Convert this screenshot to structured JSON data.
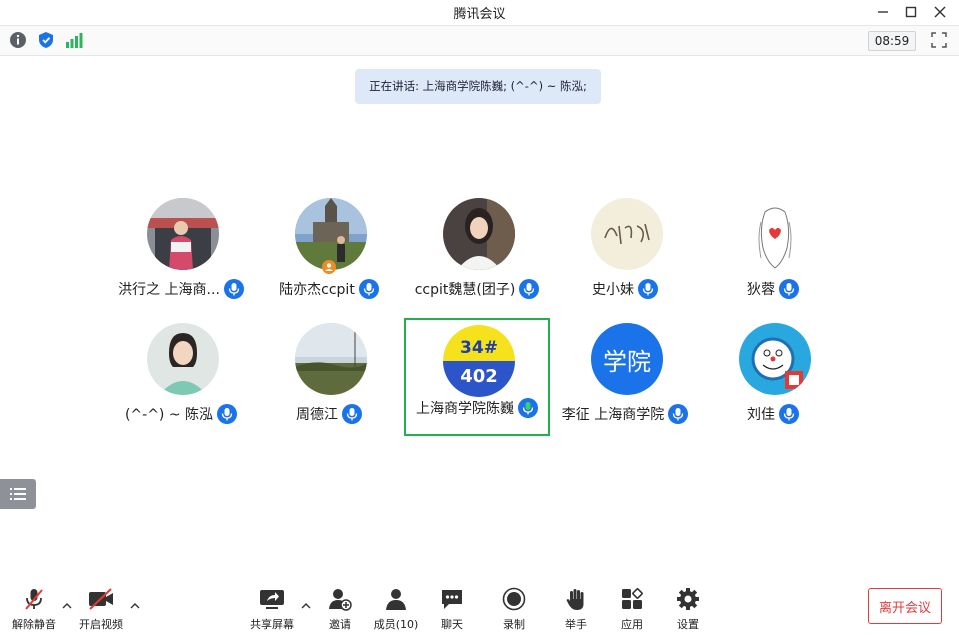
{
  "window": {
    "title": "腾讯会议"
  },
  "toolbar": {
    "timer": "08:59"
  },
  "banner": {
    "text": "正在讲话: 上海商学院陈巍; (^-^) ~ 陈泓;"
  },
  "participants": [
    {
      "name": "洪行之 上海商...",
      "mic": "blue"
    },
    {
      "name": "陆亦杰ccpit",
      "mic": "blue"
    },
    {
      "name": "ccpit魏慧(团子)",
      "mic": "blue"
    },
    {
      "name": "史小妹",
      "mic": "blue"
    },
    {
      "name": "狄蓉",
      "mic": "blue"
    },
    {
      "name": "(^-^) ~ 陈泓",
      "mic": "blue"
    },
    {
      "name": "周德江",
      "mic": "blue"
    },
    {
      "name": "上海商学院陈巍",
      "mic": "green",
      "avatar_text_top": "34#",
      "avatar_text_bottom": "402",
      "active": true
    },
    {
      "name": "李征 上海商学院",
      "mic": "blue",
      "avatar_text": "学院"
    },
    {
      "name": "刘佳",
      "mic": "blue"
    }
  ],
  "bottom": {
    "unmute": "解除静音",
    "video": "开启视频",
    "share": "共享屏幕",
    "invite": "邀请",
    "members": "成员(10)",
    "chat": "聊天",
    "record": "录制",
    "raise": "举手",
    "apps": "应用",
    "settings": "设置",
    "leave": "离开会议"
  },
  "colors": {
    "accent": "#1a73e8",
    "active_border": "#23b14d",
    "leave": "#e23b3b"
  }
}
